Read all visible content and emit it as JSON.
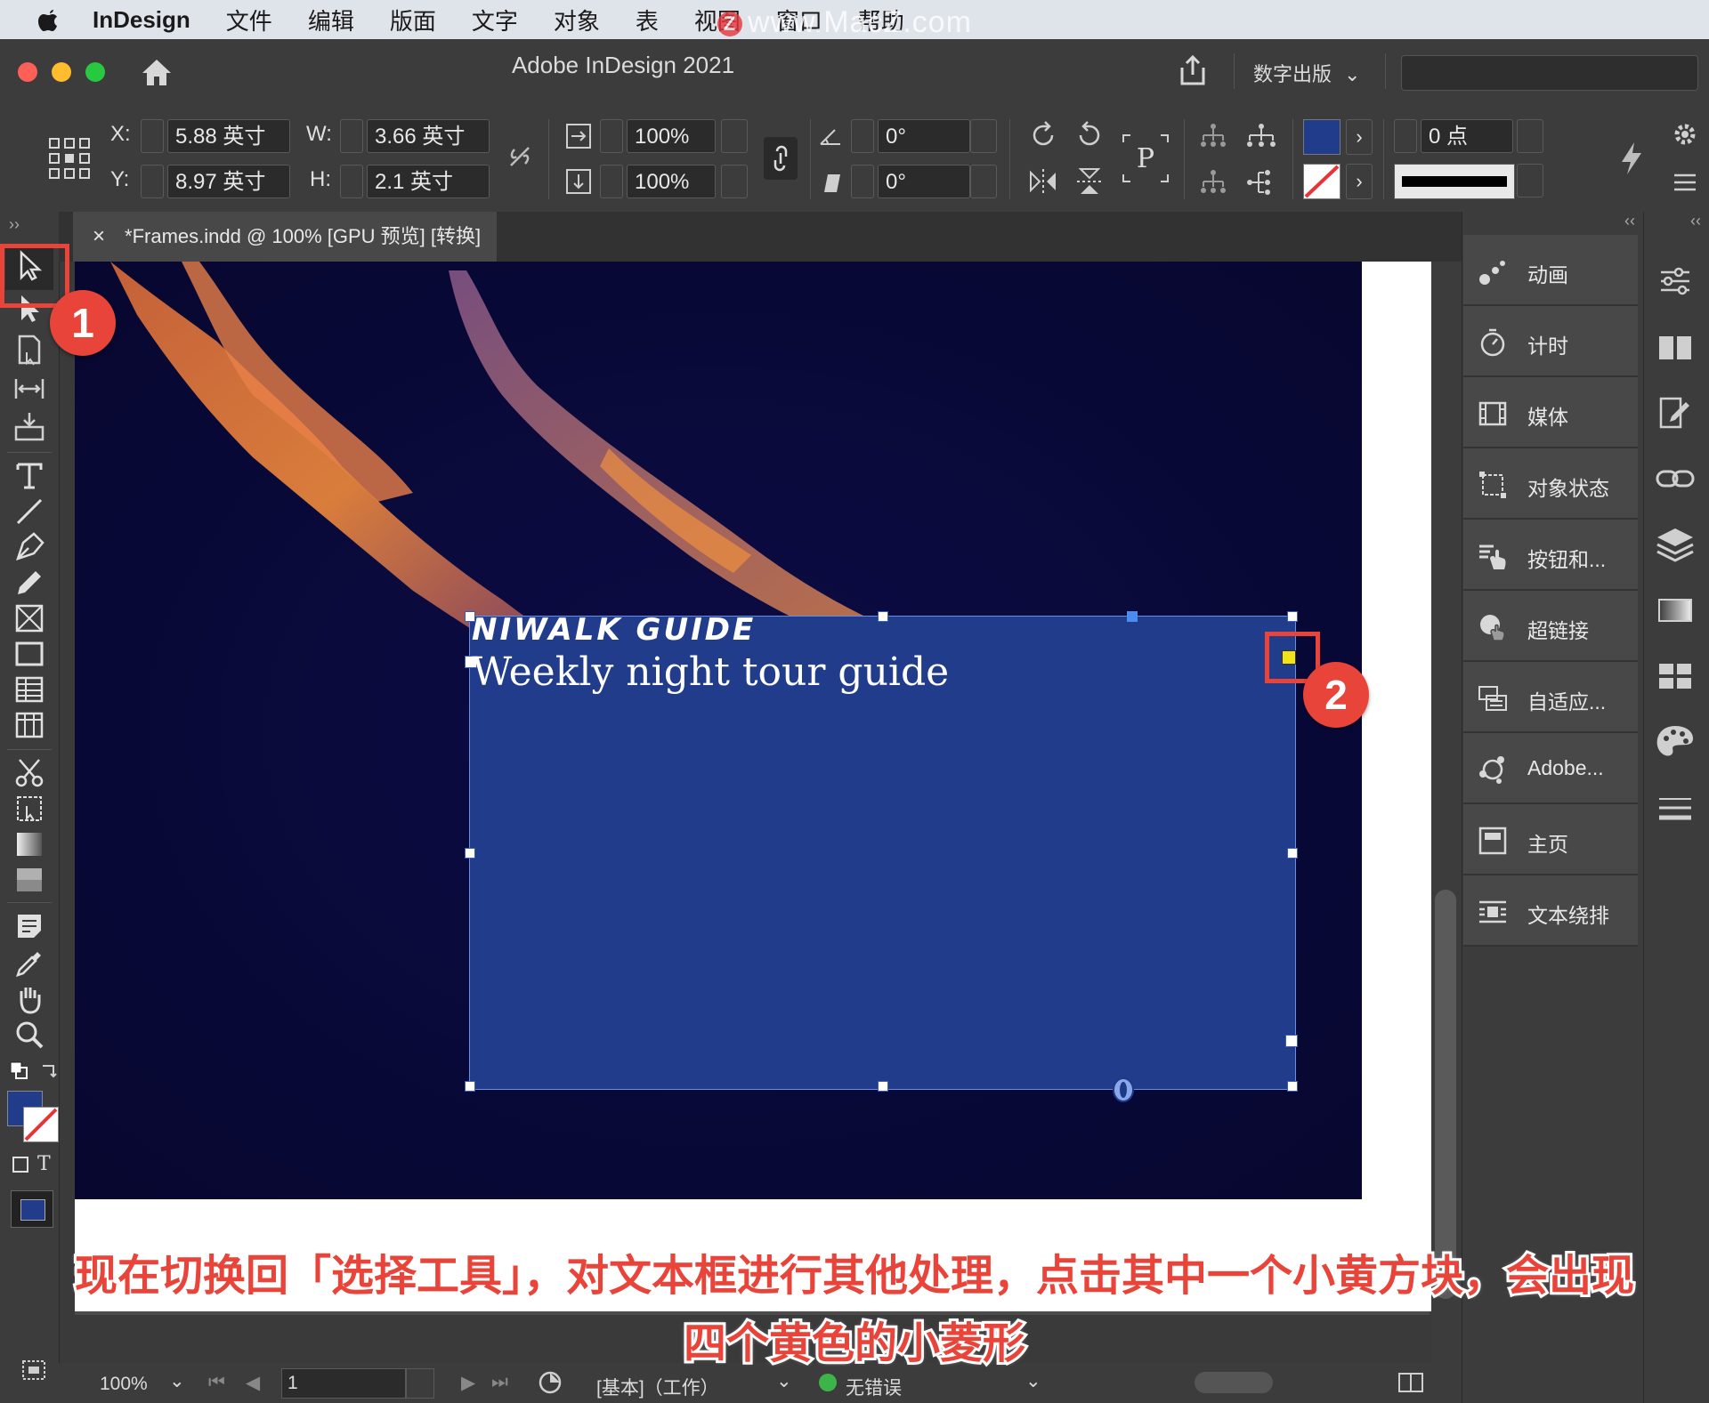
{
  "menubar": {
    "app": "InDesign",
    "items": [
      "文件",
      "编辑",
      "版面",
      "文字",
      "对象",
      "表",
      "视图",
      "窗口",
      "帮助"
    ],
    "watermark": "www.MacZ.com"
  },
  "titlebar": {
    "title": "Adobe InDesign 2021",
    "workspace": "数字出版"
  },
  "control": {
    "x_label": "X:",
    "x_value": "5.88 英寸",
    "y_label": "Y:",
    "y_value": "8.97 英寸",
    "w_label": "W:",
    "w_value": "3.66 英寸",
    "h_label": "H:",
    "h_value": "2.1 英寸",
    "scale_x": "100%",
    "scale_y": "100%",
    "rotate": "0°",
    "shear": "0°",
    "stroke_weight": "0 点",
    "fill_color": "#223c8c"
  },
  "tab": {
    "close": "×",
    "title": "*Frames.indd @ 100% [GPU 预览] [转换]"
  },
  "canvas": {
    "heading": "NIWALK  GUIDE",
    "subheading": "Weekly night tour guide",
    "frame_color": "#223c8c"
  },
  "panels": [
    {
      "label": "动画",
      "icon": "animation-icon"
    },
    {
      "label": "计时",
      "icon": "timing-icon"
    },
    {
      "label": "媒体",
      "icon": "media-icon"
    },
    {
      "label": "对象状态",
      "icon": "object-states-icon"
    },
    {
      "label": "按钮和...",
      "icon": "buttons-icon"
    },
    {
      "label": "超链接",
      "icon": "hyperlinks-icon"
    },
    {
      "label": "自适应...",
      "icon": "liquid-layout-icon"
    },
    {
      "label": "Adobe...",
      "icon": "adobe-share-icon"
    },
    {
      "label": "主页",
      "icon": "pages-icon"
    },
    {
      "label": "文本绕排",
      "icon": "text-wrap-icon"
    }
  ],
  "status": {
    "zoom": "100%",
    "page": "1",
    "master": "[基本]（工作）",
    "preflight": "无错误"
  },
  "annotations": {
    "badge1": "1",
    "badge2": "2",
    "caption_line1": "现在切换回「选择工具」，对文本框进行其他处理，点击其中一个小黄方块，会出现",
    "caption_line2": "四个黄色的小菱形"
  }
}
